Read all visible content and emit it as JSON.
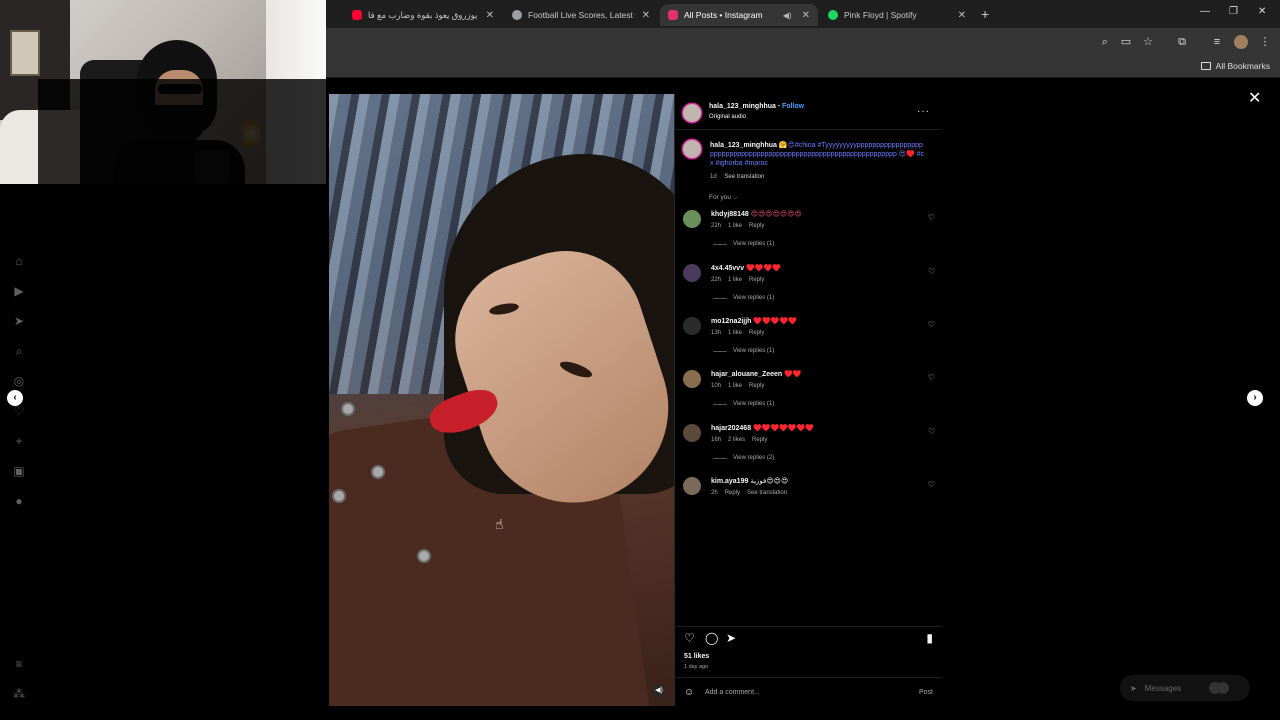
{
  "browser": {
    "tabs": [
      {
        "title": "يوزروق يعوذ بقوة وضارب مع فا",
        "color": "#ff0033",
        "active": false
      },
      {
        "title": "Football Live Scores, Latest Foo",
        "color": "#9aa0a6",
        "active": false
      },
      {
        "title": "All Posts • Instagram",
        "color": "#e1306c",
        "active": true
      },
      {
        "title": "Pink Floyd | Spotify",
        "color": "#1ed760",
        "active": false
      }
    ],
    "new_tab": "+",
    "bookmarks_label": "All Bookmarks"
  },
  "post": {
    "author": "hala_123_minghhua",
    "separator": "•",
    "follow_label": "Follow",
    "audio": "Original audio",
    "caption_user": "hala_123_minghhua",
    "caption_text": "🤗😊#china #Tyyyyyyyyyppppppppppppppppppppppppppppppppppppppppppppppppppppppppppppppppp 😍♥️ #cx #ighorba #maroc",
    "caption_time": "1d",
    "caption_translate": "See translation",
    "for_you": "For you ⌵",
    "likes": "51 likes",
    "posted": "1 day ago",
    "add_comment_placeholder": "Add a comment...",
    "post_button": "Post"
  },
  "comments": [
    {
      "user": "khdyj88148",
      "text": "😍😍😍😍😍😍😍",
      "time": "22h",
      "likes": "1 like",
      "reply": "Reply",
      "replies": "View replies (1)",
      "avatar": "#6b8f5a"
    },
    {
      "user": "4x4.45vvv",
      "text": "♥️♥️♥️♥️",
      "time": "22h",
      "likes": "1 like",
      "reply": "Reply",
      "replies": "View replies (1)",
      "avatar": "#4a3b5c"
    },
    {
      "user": "mo12na2ijjh",
      "text": "♥️♥️♥️♥️♥️",
      "time": "13h",
      "likes": "1 like",
      "reply": "Reply",
      "replies": "View replies (1)",
      "avatar": "#2b2b2b"
    },
    {
      "user": "hajar_alouane_Zeeen",
      "text": "♥️♥️",
      "time": "10h",
      "likes": "1 like",
      "reply": "Reply",
      "replies": "View replies (1)",
      "avatar": "#8a6d4e"
    },
    {
      "user": "hajar202468",
      "text": "♥️♥️♥️♥️♥️♥️♥️",
      "time": "16h",
      "likes": "2 likes",
      "reply": "Reply",
      "replies": "View replies (2)",
      "avatar": "#5c4a3a"
    },
    {
      "user": "kim.aya199",
      "text": "فوزية😍😍😍",
      "time": "2h",
      "likes": "",
      "reply": "Reply",
      "replies": "",
      "translate": "See translation",
      "avatar": "#7a6a5a"
    }
  ],
  "messages_label": "Messages"
}
